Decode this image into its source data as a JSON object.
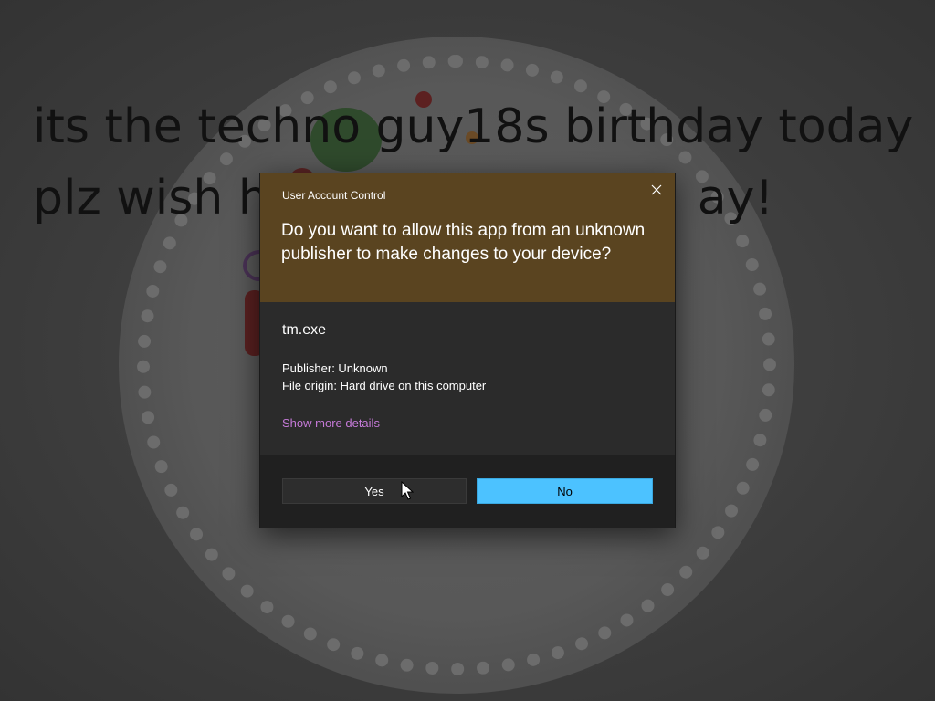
{
  "background": {
    "line1": "its the techno guy18s birthday today",
    "line2": "plz wish h",
    "line2_tail": "ay!"
  },
  "dialog": {
    "title": "User Account Control",
    "question": "Do you want to allow this app from an unknown publisher to make changes to your device?",
    "app_name": "tm.exe",
    "publisher": "Publisher: Unknown",
    "file_origin": "File origin: Hard drive on this computer",
    "details_link": "Show more details",
    "yes_label": "Yes",
    "no_label": "No",
    "close_icon": "close-icon"
  },
  "colors": {
    "header_bg": "#5a4420",
    "body_bg": "#2b2b2b",
    "footer_bg": "#202020",
    "accent": "#4cc2ff",
    "link": "#c57ad8"
  }
}
